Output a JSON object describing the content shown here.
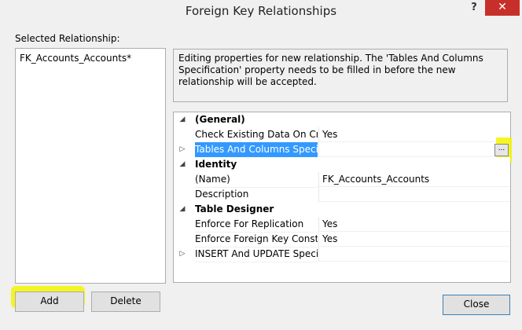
{
  "window": {
    "title": "Foreign Key Relationships",
    "help": "?",
    "close": "✕"
  },
  "left": {
    "label": "Selected Relationship:",
    "items": [
      "FK_Accounts_Accounts*"
    ]
  },
  "message": "Editing properties for new relationship.  The 'Tables And Columns Specification' property needs to be filled in before the new relationship will be accepted.",
  "grid": {
    "rows": [
      {
        "type": "category",
        "expander": "◢",
        "name": "(General)",
        "value": ""
      },
      {
        "type": "property",
        "expander": "",
        "name": "Check Existing Data On Creati",
        "value": "Yes"
      },
      {
        "type": "property",
        "expander": "▷",
        "name": "Tables And Columns Specific",
        "value": "",
        "selected": true
      },
      {
        "type": "category",
        "expander": "◢",
        "name": "Identity",
        "value": ""
      },
      {
        "type": "property",
        "expander": "",
        "name": "(Name)",
        "value": "FK_Accounts_Accounts"
      },
      {
        "type": "property",
        "expander": "",
        "name": "Description",
        "value": ""
      },
      {
        "type": "category",
        "expander": "◢",
        "name": "Table Designer",
        "value": ""
      },
      {
        "type": "property",
        "expander": "",
        "name": "Enforce For Replication",
        "value": "Yes"
      },
      {
        "type": "property",
        "expander": "",
        "name": "Enforce Foreign Key Constrair",
        "value": "Yes"
      },
      {
        "type": "property",
        "expander": "▷",
        "name": "INSERT And UPDATE Specific",
        "value": ""
      }
    ],
    "ellipsis": "..."
  },
  "buttons": {
    "add": "Add",
    "delete": "Delete",
    "close": "Close"
  },
  "colors": {
    "selection": "#3399ff",
    "highlight": "#f5f500",
    "close_x": "#c7302a"
  }
}
